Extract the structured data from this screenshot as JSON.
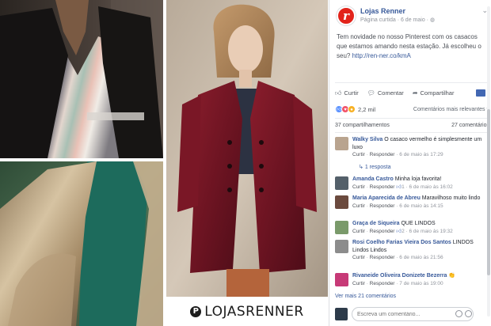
{
  "collage": {
    "brand_handle": "LOJASRENNER",
    "pinterest_glyph": "P"
  },
  "post": {
    "avatar_letter": "r",
    "page_name": "Lojas Renner",
    "meta": "Página curtida · 6 de maio ·",
    "text_before_link": "Tem novidade no nosso Pinterest com os casacos que estamos amando nesta estação. Já escolheu o seu? ",
    "link_text": "http://ren-ner.co/kmA",
    "actions": {
      "like": "Curtir",
      "comment": "Comentar",
      "share": "Compartilhar"
    },
    "reactions_count": "2,2 mil",
    "relevance": "Comentários mais relevantes ▾",
    "shares": "37 compartilhamentos",
    "comments_count": "27 comentários"
  },
  "comments": [
    {
      "author": "Walky Silva",
      "text": "O casaco vermelho é simplesmente um luxo",
      "meta": "· 6 de maio às 17:29",
      "reactions": "",
      "avatar_color": "#b9a48f"
    },
    {
      "author": "Amanda Castro",
      "text": "Minha loja favorita!",
      "meta": "· 6 de maio às 16:02",
      "reactions": "1",
      "avatar_color": "#54606a"
    },
    {
      "author": "Maria Aparecida de Abreu",
      "text": "Maravilhoso muito lindo",
      "meta": "· 6 de maio às 14:15",
      "reactions": "",
      "avatar_color": "#6b4a3e"
    },
    {
      "author": "Graça de Siqueira",
      "text": "QUE LINDOS",
      "meta": "· 6 de maio às 19:32",
      "reactions": "2",
      "avatar_color": "#7a9a6a"
    },
    {
      "author": "Rosi Coelho Farias Vieira Dos Santos",
      "text": "LINDOS Lindos Lindos",
      "meta": "· 6 de maio às 21:56",
      "reactions": "",
      "avatar_color": "#8c8c8c"
    },
    {
      "author": "Rivaneide Oliveira Donizete Bezerra",
      "text": "👏",
      "meta": "· 7 de maio às 19:00",
      "reactions": "",
      "avatar_color": "#c73a77"
    }
  ],
  "comment_links": {
    "like": "Curtir",
    "reply": "Responder"
  },
  "replies_link": "1 resposta",
  "more_comments": "Ver mais 21 comentários",
  "composer": {
    "placeholder": "Escreva um comentário..."
  },
  "colors": {
    "link": "#365899",
    "brand_red": "#e2231a",
    "like_blue": "#4267b2"
  }
}
